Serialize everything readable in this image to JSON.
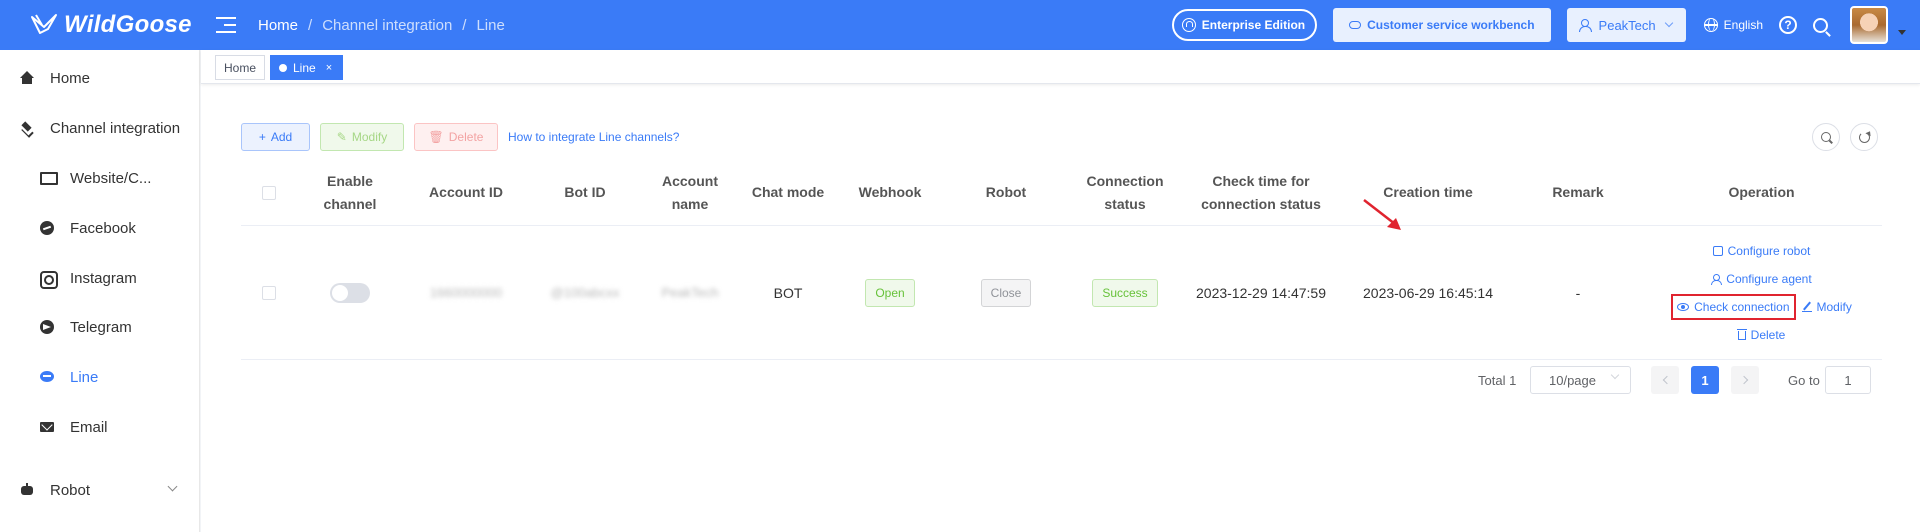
{
  "app": {
    "logo_text": "WildGoose"
  },
  "header": {
    "breadcrumb": [
      "Home",
      "Channel integration",
      "Line"
    ],
    "enterprise_label": "Enterprise Edition",
    "workbench_label": "Customer service workbench",
    "tenant_label": "PeakTech",
    "language_label": "English",
    "help_symbol": "?"
  },
  "sidebar": {
    "items": [
      {
        "label": "Home",
        "icon": "home-icon"
      },
      {
        "label": "Channel integration",
        "icon": "layers-icon",
        "expanded": true
      },
      {
        "label": "Website/C...",
        "icon": "monitor-icon"
      },
      {
        "label": "Facebook",
        "icon": "facebook-icon"
      },
      {
        "label": "Instagram",
        "icon": "instagram-icon"
      },
      {
        "label": "Telegram",
        "icon": "telegram-icon"
      },
      {
        "label": "Line",
        "icon": "line-icon",
        "active": true
      },
      {
        "label": "Email",
        "icon": "mail-icon"
      },
      {
        "label": "Robot",
        "icon": "robot-icon",
        "expanded": false
      }
    ],
    "accent_color": "#3a7bf7"
  },
  "tabs": [
    {
      "label": "Home",
      "active": false
    },
    {
      "label": "Line",
      "active": true,
      "close_symbol": "×"
    }
  ],
  "toolbar": {
    "add_label": "Add",
    "modify_label": "Modify",
    "delete_label": "Delete",
    "help_link": "How to integrate Line channels?"
  },
  "table": {
    "columns": [
      "Enable\nchannel",
      "Account ID",
      "Bot ID",
      "Account\nname",
      "Chat mode",
      "Webhook",
      "Robot",
      "Connection\nstatus",
      "Check time for\nconnection status",
      "Creation time",
      "Remark",
      "Operation"
    ],
    "rows": [
      {
        "enabled": false,
        "account_id": "1660000000",
        "bot_id": "@100abcxx",
        "account_name": "PeakTech",
        "chat_mode": "BOT",
        "webhook": "Open",
        "robot": "Close",
        "connection_status": "Success",
        "check_time": "2023-12-29 14:47:59",
        "creation_time": "2023-06-29 16:45:14",
        "remark": "-",
        "operations": {
          "configure_robot": "Configure robot",
          "configure_agent": "Configure agent",
          "check_connection": "Check connection",
          "modify": "Modify",
          "delete": "Delete"
        }
      }
    ]
  },
  "pagination": {
    "total_label": "Total 1",
    "page_size": "10/page",
    "current_page": "1",
    "goto_label": "Go to",
    "goto_value": "1"
  },
  "colors": {
    "primary": "#3a7bf7",
    "success": "#67c23a",
    "highlight": "#e0242f"
  }
}
